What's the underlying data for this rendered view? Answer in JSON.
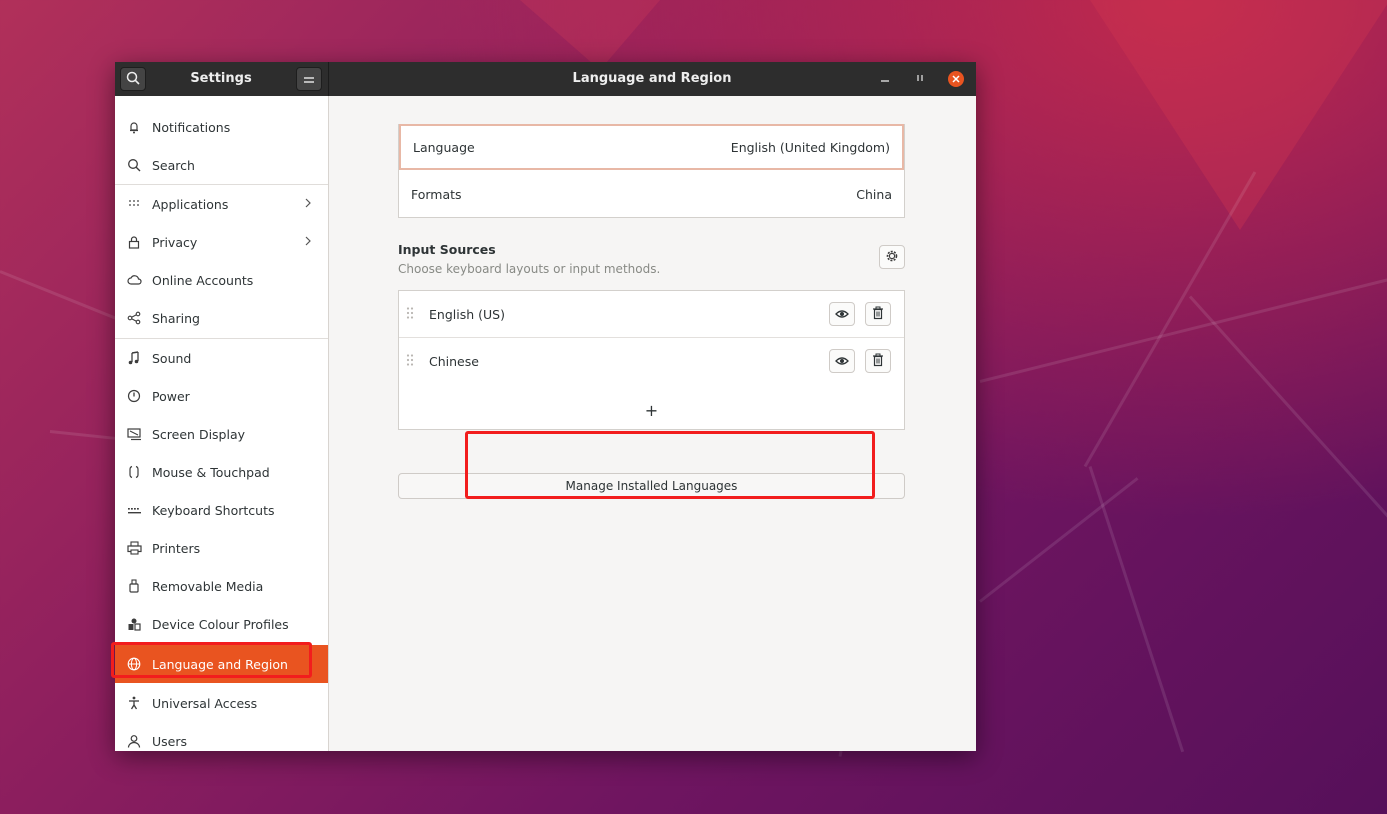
{
  "sidebar": {
    "title": "Settings",
    "items": [
      {
        "label": "Notifications",
        "icon": "bell-icon",
        "chevron": false
      },
      {
        "label": "Search",
        "icon": "search-icon",
        "chevron": false
      },
      {
        "label": "Applications",
        "icon": "grid-icon",
        "chevron": true
      },
      {
        "label": "Privacy",
        "icon": "lock-icon",
        "chevron": true
      },
      {
        "label": "Online Accounts",
        "icon": "cloud-icon",
        "chevron": false
      },
      {
        "label": "Sharing",
        "icon": "share-icon",
        "chevron": false
      },
      {
        "label": "Sound",
        "icon": "music-note-icon",
        "chevron": false
      },
      {
        "label": "Power",
        "icon": "power-icon",
        "chevron": false
      },
      {
        "label": "Screen Display",
        "icon": "display-icon",
        "chevron": false
      },
      {
        "label": "Mouse & Touchpad",
        "icon": "mouse-icon",
        "chevron": false
      },
      {
        "label": "Keyboard Shortcuts",
        "icon": "keyboard-icon",
        "chevron": false
      },
      {
        "label": "Printers",
        "icon": "printer-icon",
        "chevron": false
      },
      {
        "label": "Removable Media",
        "icon": "usb-icon",
        "chevron": false
      },
      {
        "label": "Device Colour Profiles",
        "icon": "color-profile-icon",
        "chevron": false
      },
      {
        "label": "Language and Region",
        "icon": "globe-icon",
        "chevron": false,
        "active": true
      },
      {
        "label": "Universal Access",
        "icon": "accessibility-icon",
        "chevron": false
      },
      {
        "label": "Users",
        "icon": "user-icon",
        "chevron": false
      }
    ]
  },
  "window": {
    "title": "Language and Region"
  },
  "region": {
    "language_label": "Language",
    "language_value": "English (United Kingdom)",
    "formats_label": "Formats",
    "formats_value": "China"
  },
  "input_sources": {
    "title": "Input Sources",
    "subtitle": "Choose keyboard layouts or input methods.",
    "sources": [
      {
        "name": "English (US)"
      },
      {
        "name": "Chinese"
      }
    ],
    "add_label": "+"
  },
  "manage_button": "Manage Installed Languages",
  "colors": {
    "accent": "#e95420",
    "highlight": "#f21d1d",
    "titlebar": "#2d2d2d"
  }
}
